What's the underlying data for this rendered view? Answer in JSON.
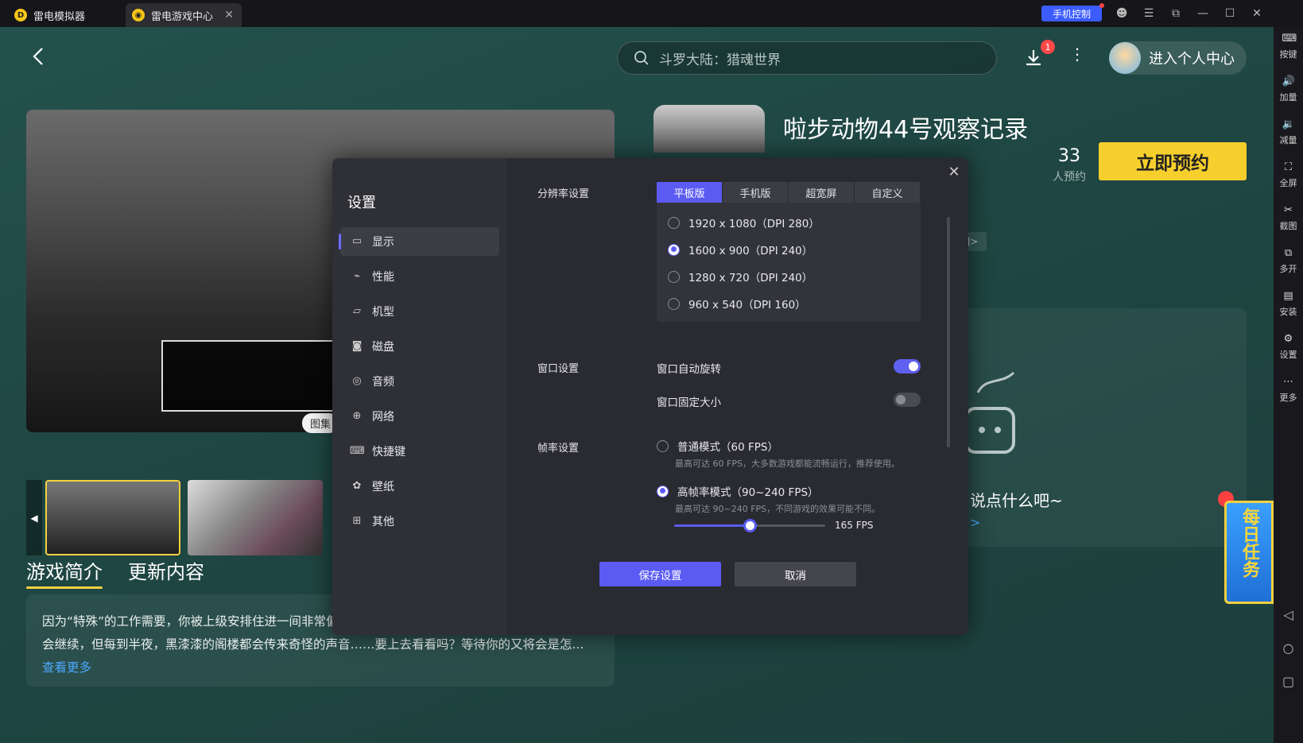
{
  "titlebar": {
    "tab1_label": "雷电模拟器",
    "tab2_label": "雷电游戏中心",
    "phone_control_label": "手机控制"
  },
  "header": {
    "search_placeholder": "斗罗大陆：猎魂世界",
    "download_badge": "1",
    "user_center_label": "进入个人中心"
  },
  "game": {
    "title": "啦步动物44号观察记录",
    "reserve_count": "33",
    "reserve_label": "人预约",
    "reserve_button": "立即预约",
    "gallery_label": "图集",
    "tag_chip": "]>",
    "comment_prompt": "说点什么吧~",
    "comment_link": ">",
    "daily_task": "每日任务"
  },
  "intro": {
    "tab_intro": "游戏简介",
    "tab_update": "更新内容",
    "text": "因为“特殊”的工作需要，你被上级安排住进一间非常偏远又荒无人烟的别墅。本以为枯燥乏味的生活将会继续，但每到半夜，黑漆漆的阁楼都会传来奇怪的声音……要上去看看吗？等待你的又将会是怎...",
    "more": "查看更多"
  },
  "toolbar": [
    {
      "label": "按键",
      "icon": "keyboard-icon"
    },
    {
      "label": "加量",
      "icon": "volume-up-icon"
    },
    {
      "label": "减量",
      "icon": "volume-down-icon"
    },
    {
      "label": "全屏",
      "icon": "fullscreen-icon"
    },
    {
      "label": "截图",
      "icon": "scissors-icon"
    },
    {
      "label": "多开",
      "icon": "multi-instance-icon"
    },
    {
      "label": "安装",
      "icon": "apk-icon"
    },
    {
      "label": "设置",
      "icon": "gear-icon"
    },
    {
      "label": "更多",
      "icon": "more-icon"
    }
  ],
  "settings": {
    "title": "设置",
    "menu": [
      {
        "label": "显示",
        "icon": "monitor-icon",
        "active": true
      },
      {
        "label": "性能",
        "icon": "performance-icon"
      },
      {
        "label": "机型",
        "icon": "folder-icon"
      },
      {
        "label": "磁盘",
        "icon": "disk-icon"
      },
      {
        "label": "音频",
        "icon": "gamepad-icon"
      },
      {
        "label": "网络",
        "icon": "globe-icon"
      },
      {
        "label": "快捷键",
        "icon": "keyboard-icon"
      },
      {
        "label": "壁纸",
        "icon": "palette-icon"
      },
      {
        "label": "其他",
        "icon": "grid-icon"
      }
    ],
    "resolution": {
      "label": "分辨率设置",
      "tabs": [
        "平板版",
        "手机版",
        "超宽屏",
        "自定义"
      ],
      "active_tab": "平板版",
      "options": [
        "1920 x 1080（DPI 280）",
        "1600 x 900（DPI 240）",
        "1280 x 720（DPI 240）",
        "960 x 540（DPI 160）"
      ],
      "selected": "1600 x 900（DPI 240）"
    },
    "window": {
      "label": "窗口设置",
      "auto_rotate": "窗口自动旋转",
      "auto_rotate_on": true,
      "fixed_size": "窗口固定大小",
      "fixed_size_on": false
    },
    "fps": {
      "label": "帧率设置",
      "normal_label": "普通模式（60 FPS）",
      "normal_desc": "最高可达 60 FPS，大多数游戏都能流畅运行，推荐使用。",
      "high_label": "高帧率模式（90~240 FPS）",
      "high_desc": "最高可达 90~240 FPS，不同游戏的效果可能不同。",
      "selected": "high",
      "value": 165,
      "min": 90,
      "max": 240,
      "value_label": "165 FPS"
    },
    "save_button": "保存设置",
    "cancel_button": "取消"
  },
  "colors": {
    "accent": "#5b5bf4",
    "reserve": "#f7cf2d",
    "link": "#4aa8ff"
  }
}
